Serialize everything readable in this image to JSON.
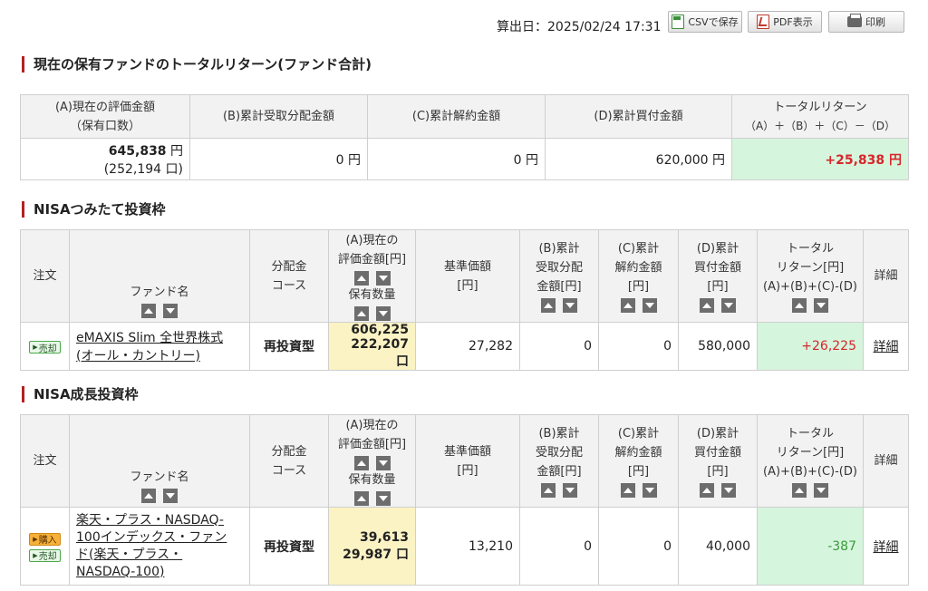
{
  "header": {
    "calc_date": "算出日：2025/02/24 17:31",
    "csv_label": "CSVで保存",
    "pdf_label": "PDF表示",
    "print_label": "印刷"
  },
  "summary": {
    "title": "現在の保有ファンドのトータルリターン(ファンド合計)",
    "headers": {
      "a_line1": "(A)現在の評価金額",
      "a_line2": "（保有口数）",
      "b": "(B)累計受取分配金額",
      "c": "(C)累計解約金額",
      "d": "(D)累計買付金額",
      "t_line1": "トータルリターン",
      "t_line2": "（A）＋（B）＋（C）－（D）"
    },
    "values": {
      "a_amount": "645,838",
      "a_unit": " 円",
      "a_units": "(252,194 口)",
      "b": "0 円",
      "c": "0 円",
      "d": "620,000 円",
      "total": "+25,838 円"
    }
  },
  "col_headers": {
    "order": "注文",
    "fund": "ファンド名",
    "course_l1": "分配金",
    "course_l2": "コース",
    "a_l1": "(A)現在の",
    "a_l2": "評価金額[円]",
    "a_l3": "保有数量",
    "nav_l1": "基準価額",
    "nav_l2": "[円]",
    "b_l1": "(B)累計",
    "b_l2": "受取分配",
    "b_l3": "金額[円]",
    "c_l1": "(C)累計",
    "c_l2": "解約金額",
    "c_l3": "[円]",
    "d_l1": "(D)累計",
    "d_l2": "買付金額",
    "d_l3": "[円]",
    "t_l1": "トータル",
    "t_l2": "リターン[円]",
    "t_l3": "(A)+(B)+(C)-(D)",
    "detail": "詳細"
  },
  "nisa_tsumitate": {
    "title": "NISAつみたて投資枠",
    "row": {
      "sell": "売却",
      "fund_line1": "eMAXIS Slim 全世界株式",
      "fund_line2": "(オール・カントリー)",
      "course": "再投資型",
      "valuation": "606,225",
      "quantity": "222,207 口",
      "nav": "27,282",
      "b": "0",
      "c": "0",
      "d": "580,000",
      "total": "+26,225",
      "detail": "詳細"
    }
  },
  "nisa_seicho": {
    "title": "NISA成長投資枠",
    "row": {
      "buy": "購入",
      "sell": "売却",
      "fund_line1": "楽天・プラス・NASDAQ-",
      "fund_line2": "100インデックス・ファン",
      "fund_line3": "ド(楽天・プラス・",
      "fund_line4": "NASDAQ-100)",
      "course": "再投資型",
      "valuation": "39,613",
      "quantity": "29,987 口",
      "nav": "13,210",
      "b": "0",
      "c": "0",
      "d": "40,000",
      "total": "-387",
      "detail": "詳細"
    }
  },
  "colors": {
    "accent_bar": "#b22222",
    "gain": "#d7262b",
    "loss": "#3a9a3a",
    "return_bg": "#d6f5dd",
    "valuation_bg": "#fbf3c4"
  }
}
